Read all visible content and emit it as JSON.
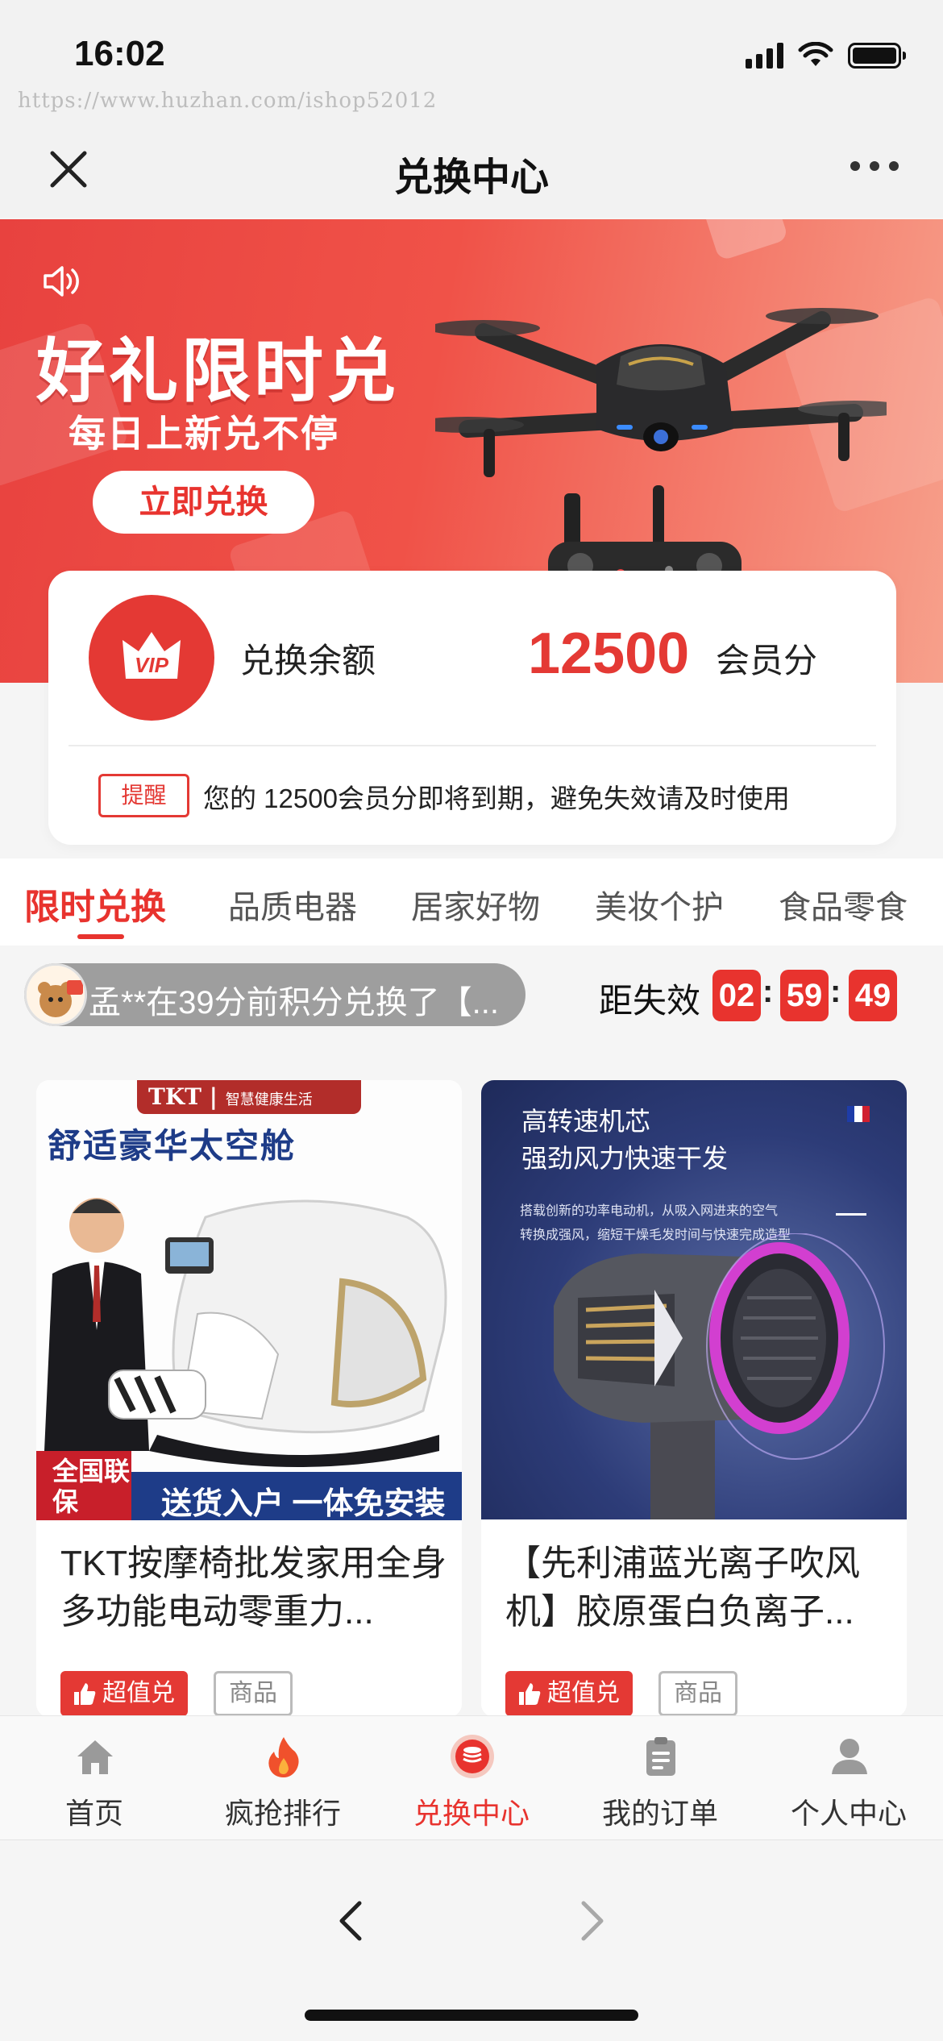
{
  "status_bar": {
    "time": "16:02",
    "watermark": "https://www.huzhan.com/ishop52012"
  },
  "nav": {
    "title": "兑换中心"
  },
  "banner": {
    "title": "好礼限时兑",
    "subtitle": "每日上新兑不停",
    "cta_label": "立即兑换",
    "accent_color": "#e8423f"
  },
  "balance": {
    "label": "兑换余额",
    "amount": "12500",
    "unit": "会员分",
    "remind_tag": "提醒",
    "remind_text": "您的 12500会员分即将到期，避免失效请及时使用"
  },
  "tabs": [
    {
      "label": "限时兑换",
      "active": true
    },
    {
      "label": "品质电器",
      "active": false
    },
    {
      "label": "居家好物",
      "active": false
    },
    {
      "label": "美妆个护",
      "active": false
    },
    {
      "label": "食品零食",
      "active": false
    }
  ],
  "ticker": {
    "text": "孟**在39分前积分兑换了【..."
  },
  "countdown": {
    "label": "距失效",
    "hours": "02",
    "minutes": "59",
    "seconds": "49"
  },
  "products": [
    {
      "title": "TKT按摩椅批发家用全身多功能电动零重力...",
      "badge_hot": "超值兑",
      "badge_goods": "商品",
      "image": {
        "brand": "TKT",
        "brand_sub": "智慧健康生活",
        "headline": "舒适豪华太空舱",
        "corner": "全国联保",
        "bar_text": "送货入户 一体免安装"
      }
    },
    {
      "title": "【先利浦蓝光离子吹风机】胶原蛋白负离子...",
      "badge_hot": "超值兑",
      "badge_goods": "商品",
      "image": {
        "headline_1": "高转速机芯",
        "headline_2": "强劲风力快速干发",
        "desc_1": "搭载创新的功率电动机，从吸入网进来的空气",
        "desc_2": "转换成强风，缩短干燥毛发时间与快速完成造型"
      }
    }
  ],
  "bottom_tabs": [
    {
      "label": "首页",
      "icon": "home-icon",
      "active": false
    },
    {
      "label": "疯抢排行",
      "icon": "fire-icon",
      "active": false
    },
    {
      "label": "兑换中心",
      "icon": "coins-icon",
      "active": true
    },
    {
      "label": "我的订单",
      "icon": "clipboard-icon",
      "active": false
    },
    {
      "label": "个人中心",
      "icon": "user-icon",
      "active": false
    }
  ]
}
